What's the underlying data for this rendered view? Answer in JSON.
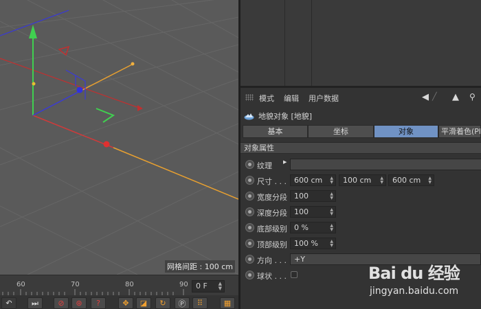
{
  "viewport": {
    "grid_spacing": "网格间距 : 100 cm"
  },
  "timeline": {
    "ticks": [
      "60",
      "70",
      "80",
      "90"
    ],
    "frame_value": "0 F"
  },
  "attribute_manager": {
    "menu": [
      "模式",
      "编辑",
      "用户数据"
    ],
    "object_title": "地貌对象 [地貌]",
    "tabs": [
      "基本",
      "坐标",
      "对象",
      "平滑着色(Ph"
    ],
    "active_tab": "对象",
    "section_title": "对象属性",
    "rows": {
      "texture": {
        "label": "纹理"
      },
      "size": {
        "label": "尺寸 . . .",
        "values": [
          "600 cm",
          "100 cm",
          "600 cm"
        ]
      },
      "width_segments": {
        "label": "宽度分段",
        "value": "100"
      },
      "depth_segments": {
        "label": "深度分段",
        "value": "100"
      },
      "bottom_level": {
        "label": "底部级别",
        "value": "0 %"
      },
      "top_level": {
        "label": "顶部级别",
        "value": "100 %"
      },
      "direction": {
        "label": "方向 . . .",
        "value": "+Y"
      },
      "spherical": {
        "label": "球状 . . ."
      }
    }
  },
  "watermark": {
    "logo": "Bai du 经验",
    "url": "jingyan.baidu.com"
  },
  "colors": {
    "active_tab": "#7092c4",
    "axis_x": "#e03a3a",
    "axis_y": "#2fd04a",
    "axis_z": "#3a3ad8",
    "handle_orange": "#f0a030"
  }
}
